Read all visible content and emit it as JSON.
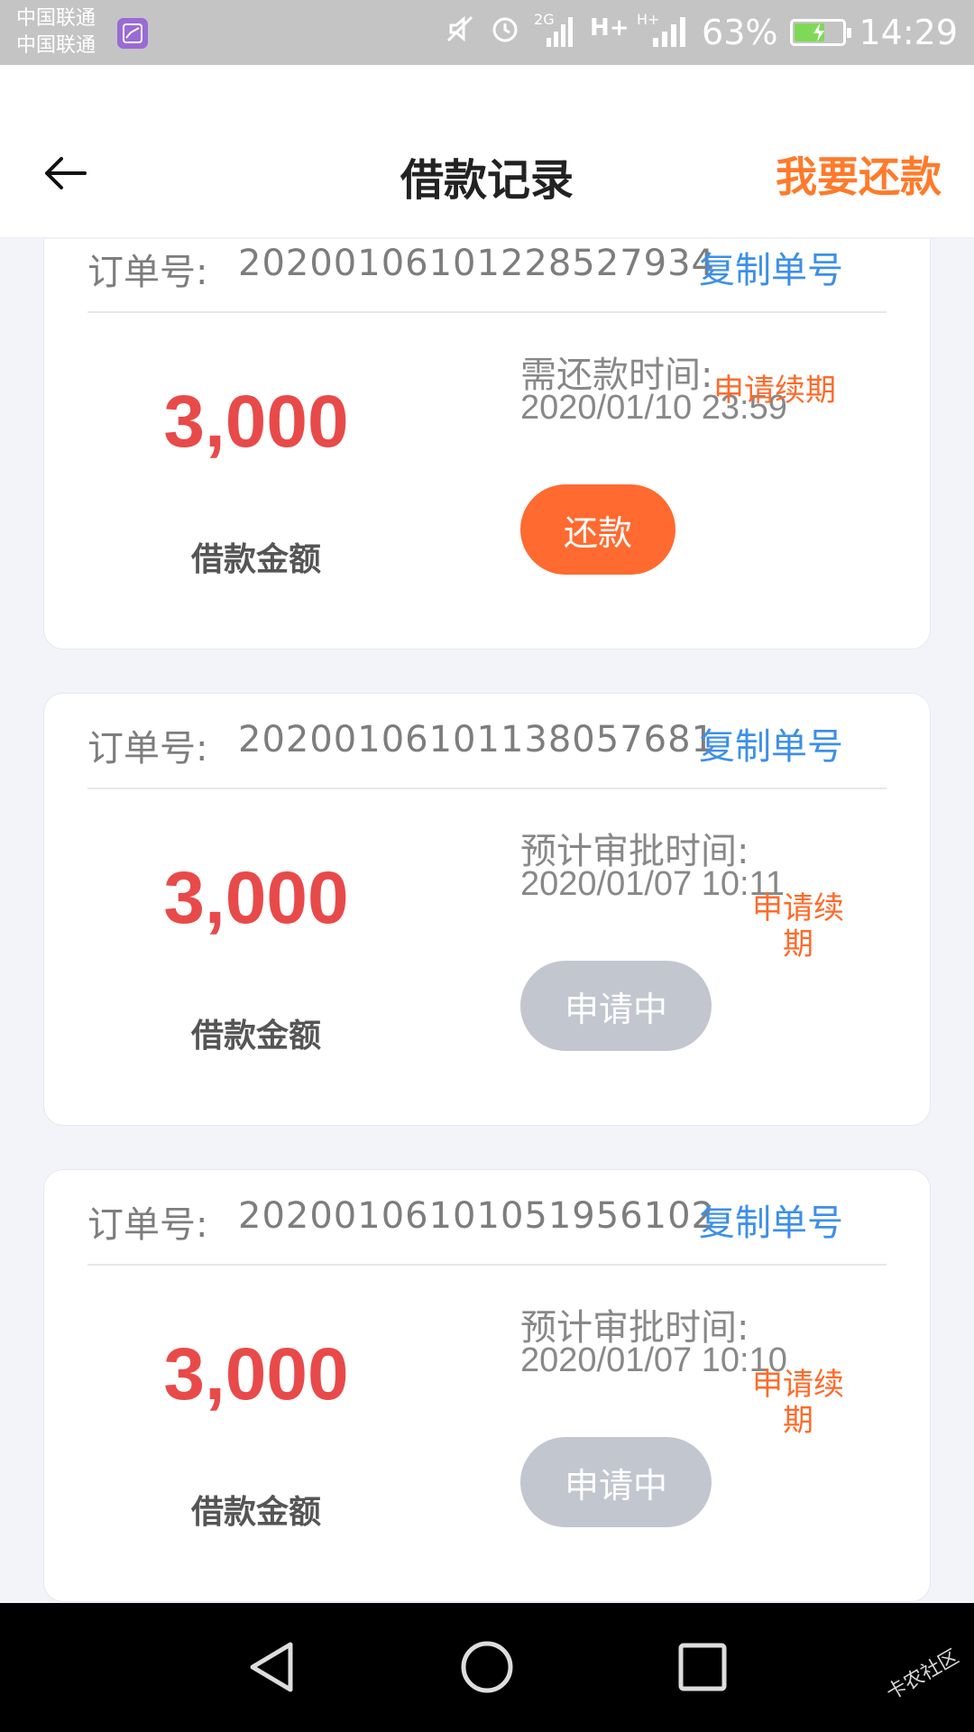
{
  "status_bar": {
    "carrier1": "中国联通",
    "carrier2": "中国联通",
    "signal_2g_label": "2G",
    "signal_h_label1": "H+",
    "signal_h_label2": "H+",
    "battery_percent": "63%",
    "battery_level": 0.63,
    "time": "14:29",
    "icons": [
      "gallery-icon",
      "mute-icon",
      "alarm-icon",
      "signal-icon",
      "battery-icon"
    ]
  },
  "header": {
    "title": "借款记录",
    "action": "我要还款"
  },
  "records": [
    {
      "order_label": "订单号:",
      "order_no": "20200106101228527934",
      "copy_label": "复制单号",
      "amount": "3,000",
      "amount_label": "借款金额",
      "time_label": "需还款时间:",
      "time_value": "2020/01/10 23:59",
      "renew_label": "申请续期",
      "button_label": "还款",
      "button_state": "primary"
    },
    {
      "order_label": "订单号:",
      "order_no": "20200106101138057681",
      "copy_label": "复制单号",
      "amount": "3,000",
      "amount_label": "借款金额",
      "time_label": "预计审批时间:",
      "time_value": "2020/01/07 10:11",
      "renew_label_line1": "申请续",
      "renew_label_line2": "期",
      "button_label": "申请中",
      "button_state": "disabled"
    },
    {
      "order_label": "订单号:",
      "order_no": "20200106101051956102",
      "copy_label": "复制单号",
      "amount": "3,000",
      "amount_label": "借款金额",
      "time_label": "预计审批时间:",
      "time_value": "2020/01/07 10:10",
      "renew_label_line1": "申请续",
      "renew_label_line2": "期",
      "button_label": "申请中",
      "button_state": "disabled"
    }
  ],
  "nav_bar": {
    "icons": [
      "back-triangle-icon",
      "home-circle-icon",
      "recents-square-icon"
    ],
    "watermark": "卡农社区"
  },
  "colors": {
    "accent_orange": "#ff6a30",
    "amount_red": "#e84a4a",
    "link_blue": "#3d8fe8",
    "disabled_gray": "#c2c6cf"
  }
}
